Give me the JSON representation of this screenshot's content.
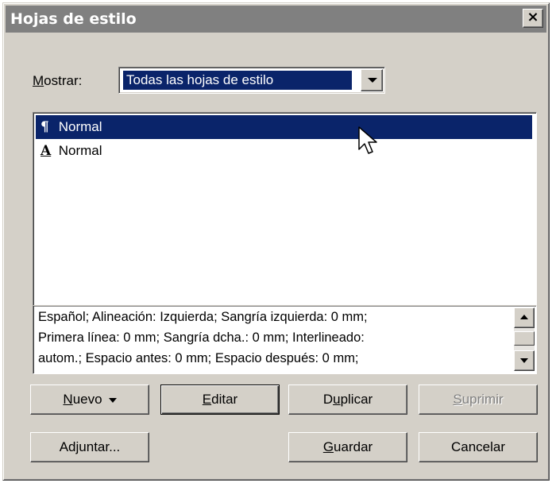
{
  "dialog": {
    "title": "Hojas de estilo",
    "close_glyph": "×"
  },
  "show": {
    "label_mnemonic": "M",
    "label_rest": "ostrar:",
    "selected": "Todas las hojas de estilo"
  },
  "styles_list": {
    "items": [
      {
        "icon": "paragraph-style-icon",
        "glyph": "¶",
        "label": "Normal",
        "selected": true
      },
      {
        "icon": "character-style-icon",
        "glyph": "A",
        "label": "Normal",
        "selected": false
      }
    ]
  },
  "description": {
    "lines": [
      "Español;  Alineación: Izquierda;  Sangría izquierda: 0 mm;",
      "Primera línea: 0 mm;  Sangría dcha.: 0 mm;  Interlineado:",
      "autom.;  Espacio antes: 0 mm;  Espacio después: 0 mm;"
    ]
  },
  "buttons": {
    "new_mn": "N",
    "new_rest": "uevo",
    "edit_mn": "E",
    "edit_rest": "ditar",
    "dup_a": "D",
    "dup_mn": "u",
    "dup_rest": "plicar",
    "delete_mn": "S",
    "delete_rest": "uprimir",
    "append": "Adjuntar...",
    "save_mn": "G",
    "save_rest": "uardar",
    "cancel": "Cancelar"
  },
  "colors": {
    "face": "#d4d0c8",
    "selection": "#0a246a",
    "titlebar_inactive": "#808080"
  }
}
